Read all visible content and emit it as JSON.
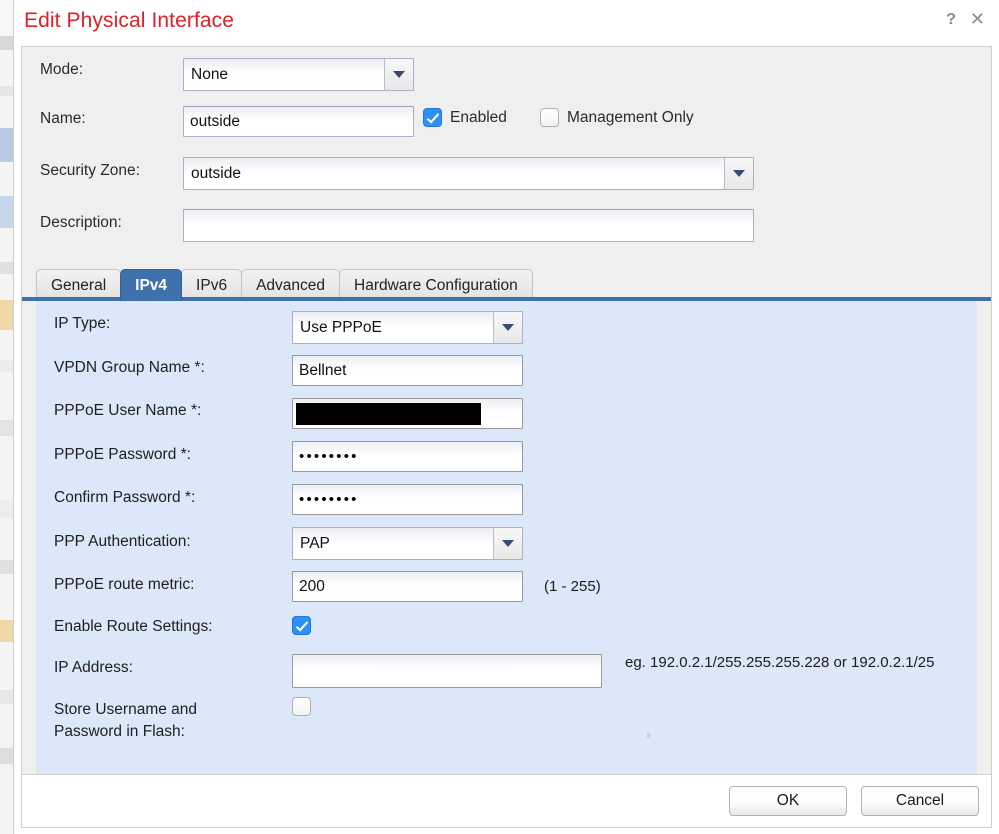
{
  "dialog": {
    "title": "Edit Physical Interface",
    "help_icon": "?",
    "close_icon": "✕"
  },
  "form": {
    "mode_label": "Mode:",
    "mode_value": "None",
    "name_label": "Name:",
    "name_value": "outside",
    "enabled_label": "Enabled",
    "enabled_checked": true,
    "management_only_label": "Management Only",
    "management_only_checked": false,
    "security_zone_label": "Security Zone:",
    "security_zone_value": "outside",
    "description_label": "Description:",
    "description_value": ""
  },
  "tabs": [
    {
      "label": "General",
      "active": false
    },
    {
      "label": "IPv4",
      "active": true
    },
    {
      "label": "IPv6",
      "active": false
    },
    {
      "label": "Advanced",
      "active": false
    },
    {
      "label": "Hardware Configuration",
      "active": false
    }
  ],
  "ipv4": {
    "ip_type_label": "IP Type:",
    "ip_type_value": "Use PPPoE",
    "vpdn_group_label": "VPDN Group Name *:",
    "vpdn_group_value": "Bellnet",
    "pppoe_user_label": "PPPoE User Name *:",
    "pppoe_user_value": "",
    "pppoe_password_label": "PPPoE Password *:",
    "pppoe_password_value": "••••••••",
    "confirm_password_label": "Confirm Password *:",
    "confirm_password_value": "••••••••",
    "ppp_auth_label": "PPP Authentication:",
    "ppp_auth_value": "PAP",
    "route_metric_label": "PPPoE route metric:",
    "route_metric_value": "200",
    "route_metric_hint": "(1 - 255)",
    "enable_route_label": "Enable Route Settings:",
    "enable_route_checked": true,
    "ip_address_label": "IP Address:",
    "ip_address_value": "",
    "ip_address_hint": "eg. 192.0.2.1/255.255.255.228 or 192.0.2.1/25",
    "store_credentials_label": "Store Username and Password in Flash:",
    "store_credentials_checked": false
  },
  "footer": {
    "ok_label": "OK",
    "cancel_label": "Cancel"
  },
  "colors": {
    "title_red": "#e01f28",
    "panel_blue": "#dce7fa",
    "tab_active_blue": "#3f71ad",
    "checkbox_blue": "#2f8ff5"
  }
}
